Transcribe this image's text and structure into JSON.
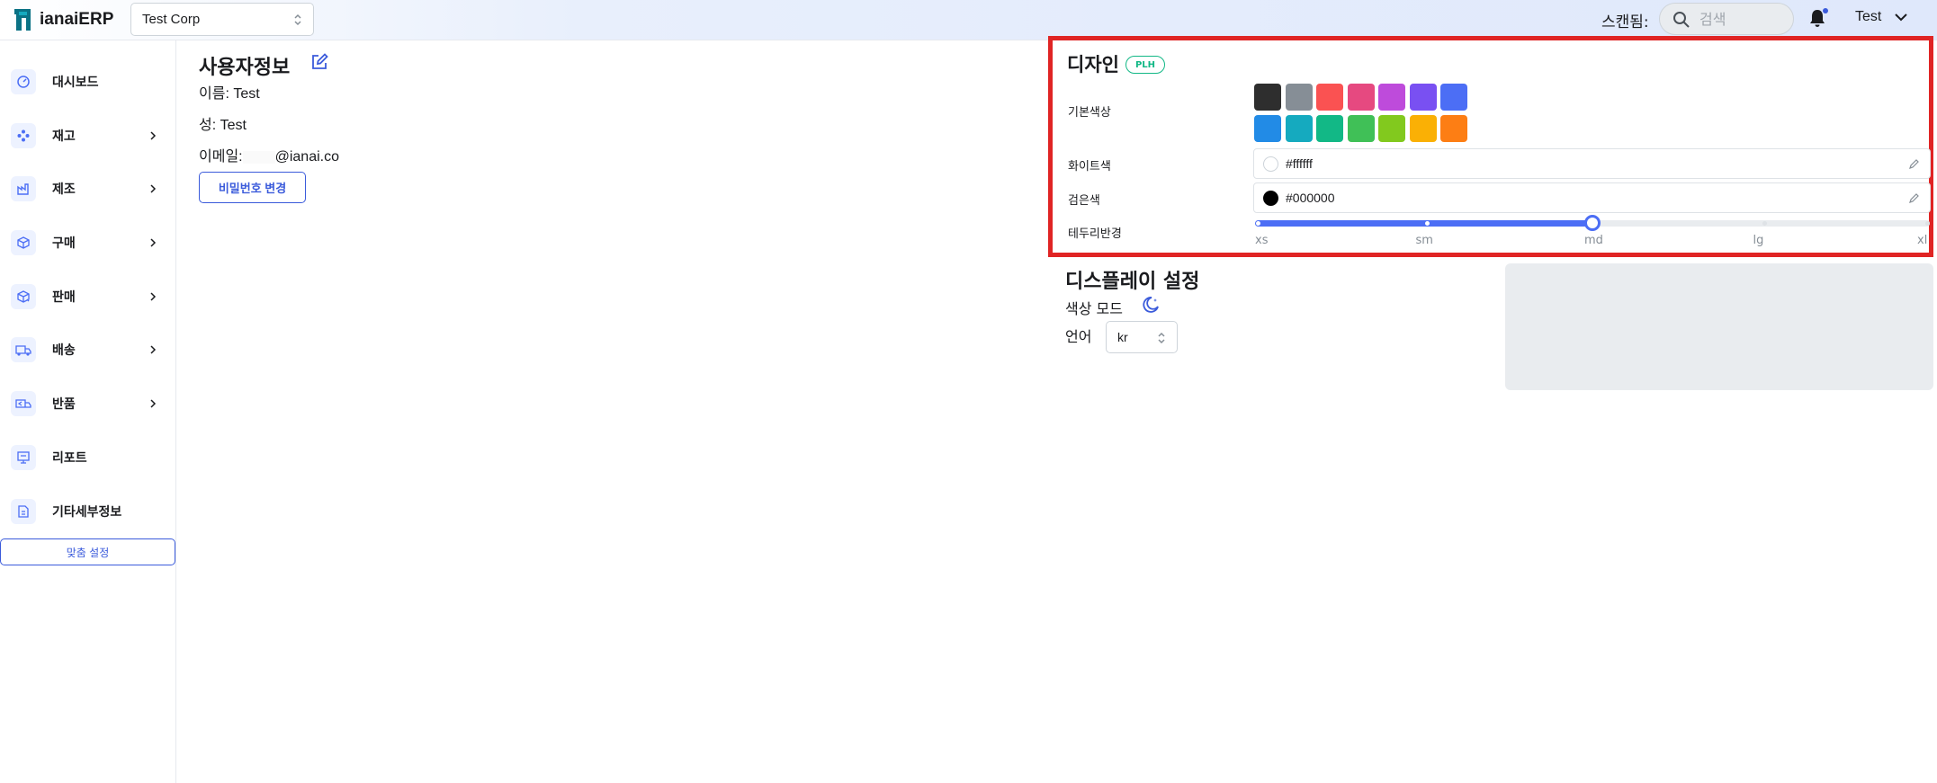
{
  "app": {
    "brand_name": "ianaiERP",
    "company": "Test Corp",
    "scan_label": "스캔됨:",
    "search_placeholder": "검색",
    "user_name": "Test",
    "accent_color": "#3b5bdb"
  },
  "sidebar": {
    "items": [
      {
        "label": "대시보드",
        "icon": "dashboard-icon",
        "has_children": false
      },
      {
        "label": "재고",
        "icon": "inventory-icon",
        "has_children": true
      },
      {
        "label": "제조",
        "icon": "factory-icon",
        "has_children": true
      },
      {
        "label": "구매",
        "icon": "purchase-box-icon",
        "has_children": true
      },
      {
        "label": "판매",
        "icon": "sale-box-icon",
        "has_children": true
      },
      {
        "label": "배송",
        "icon": "truck-icon",
        "has_children": true
      },
      {
        "label": "반품",
        "icon": "return-truck-icon",
        "has_children": true
      },
      {
        "label": "리포트",
        "icon": "report-icon",
        "has_children": false
      },
      {
        "label": "기타세부정보",
        "icon": "document-icon",
        "has_children": false
      }
    ],
    "custom_settings_label": "맞춤 설정"
  },
  "user_info": {
    "title": "사용자정보",
    "first_name_line": "이름: Test",
    "last_name_line": "성: Test",
    "email_prefix": "이메일:",
    "email_suffix": "@ianai.co",
    "change_password_label": "비밀번호 변경"
  },
  "design": {
    "title": "디자인",
    "badge": "PLH",
    "base_color_label": "기본색상",
    "swatches_row1": [
      "#2e2e2e",
      "#868e96",
      "#fa5252",
      "#e64980",
      "#be4bdb",
      "#7950f2",
      "#4c6ef5"
    ],
    "swatches_row2": [
      "#228be6",
      "#15aabf",
      "#12b886",
      "#40c057",
      "#82c91e",
      "#fab005",
      "#fd7e14"
    ],
    "white_label": "화이트색",
    "white_value": "#ffffff",
    "black_label": "검은색",
    "black_value": "#000000",
    "radius_label": "테두리반경",
    "radius_options": [
      "xs",
      "sm",
      "md",
      "lg",
      "xl"
    ],
    "radius_selected_index": 2
  },
  "display": {
    "title": "디스플레이 설정",
    "color_mode_label": "색상 모드",
    "language_label": "언어",
    "language_value": "kr"
  }
}
